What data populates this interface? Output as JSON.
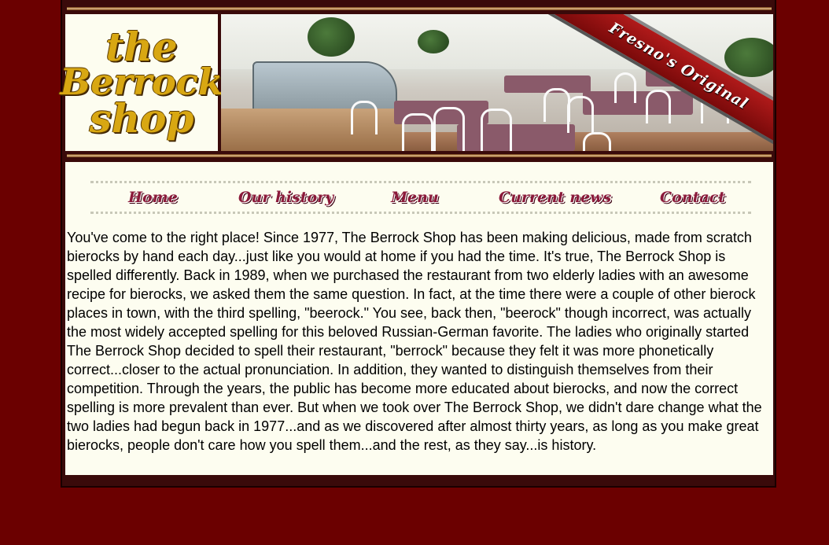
{
  "logo": {
    "line1": "the",
    "line2": "Berrock",
    "line3": "shop"
  },
  "banner": {
    "ribbon_text": "Fresno's Original"
  },
  "nav": {
    "items": [
      {
        "label": "Home"
      },
      {
        "label": "Our history"
      },
      {
        "label": "Menu"
      },
      {
        "label": "Current news"
      },
      {
        "label": "Contact"
      }
    ]
  },
  "main": {
    "paragraph": "You've come to the right place! Since 1977, The Berrock Shop has been making delicious, made from scratch bierocks by hand each day...just like you would at home if you had the time. It's true, The Berrock Shop is spelled differently. Back in 1989, when we purchased the restaurant from two elderly ladies with an awesome recipe for bierocks, we asked them the same question. In fact, at the time there were a couple of other bierock places in town, with the third spelling, \"beerock.\" You see, back then, \"beerock\" though incorrect, was actually the most widely accepted spelling for this beloved Russian-German favorite. The ladies who originally started The Berrock Shop decided to spell their restaurant, \"berrock\" because they felt it was more phonetically correct...closer to the actual pronunciation. In addition, they wanted to distinguish themselves from their competition. Through the years, the public has become more educated about bierocks, and now the correct spelling is more prevalent than ever. But when we took over The Berrock Shop, we didn't dare change what the two ladies had begun back in 1977...and as we discovered after almost thirty years, as long as you make great bierocks, people don't care how you spell them...and the rest, as they say...is history."
  },
  "colors": {
    "page_background": "#6b0000",
    "content_background": "#fdfdf0",
    "logo_gold": "#d8a712",
    "nav_text": "#8b1a3a"
  }
}
